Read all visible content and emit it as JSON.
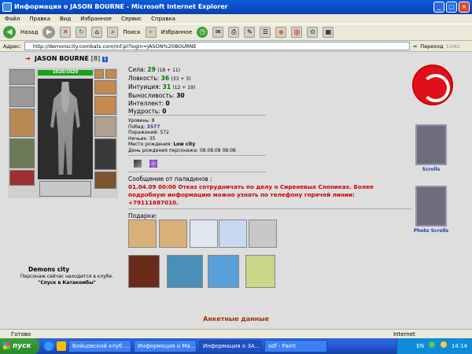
{
  "window": {
    "title": "Информация о JASON BOURNE - Microsoft Internet Explorer",
    "buttons": [
      "_",
      "□",
      "×"
    ]
  },
  "menu": [
    "Файл",
    "Правка",
    "Вид",
    "Избранное",
    "Сервис",
    "Справка"
  ],
  "toolbar": {
    "back": "Назад",
    "search": "Поиск",
    "favorites": "Избранное"
  },
  "address": {
    "label": "Адрес:",
    "url": "http://demonscity.combats.com/inf.pl?login=JASON%20BOURNE",
    "go": "Переход",
    "links": "Links"
  },
  "character": {
    "name": "JASON BOURNE",
    "level": "[8]",
    "hp": "1020/1020",
    "city": "Demons city",
    "location_text": "Персонаж сейчас находится в клубе.",
    "location_name": "\"Спуск в Катакомбы\""
  },
  "stats": [
    {
      "label": "Сила:",
      "value": "29",
      "bonus": "(18 + 11)"
    },
    {
      "label": "Ловкость:",
      "value": "36",
      "bonus": "(33 + 3)"
    },
    {
      "label": "Интуиция:",
      "value": "31",
      "bonus": "(12 + 19)"
    },
    {
      "label": "Выносливость:",
      "value": "30",
      "bonus": ""
    },
    {
      "label": "Интеллект:",
      "value": "0",
      "bonus": ""
    },
    {
      "label": "Мудрость:",
      "value": "0",
      "bonus": ""
    }
  ],
  "info": [
    {
      "label": "Уровень:",
      "value": "8"
    },
    {
      "label": "Побед:",
      "value": "3577"
    },
    {
      "label": "Поражений:",
      "value": "572"
    },
    {
      "label": "Ничьих:",
      "value": "35"
    },
    {
      "label": "Место рождения:",
      "value": "Low city"
    },
    {
      "label": "День рождения персонажа:",
      "value": "08.08.08 08:08"
    }
  ],
  "message": {
    "title": "Сообщение от паладинов :",
    "text": "01.04.09 00:00 Отказ сотрудничать по делу о Сиреневых Слониках. Более подробную информацию можно узнать по телефону горячей линии: +79111687010."
  },
  "gifts_label": "Подарки:",
  "side": {
    "scrolls": "Scrolls",
    "photo_scrolls": "Photo Scrolls"
  },
  "anket": "Анкетные данные",
  "status": {
    "text": "Готово",
    "zone": "Internet"
  },
  "taskbar": {
    "start": "пуск",
    "tasks": [
      "Бойцовский клуб ...",
      "Информация о Ма...",
      "Информация о ЗА...",
      "sdf - Paint"
    ],
    "lang": "EN",
    "time": "14:14"
  }
}
